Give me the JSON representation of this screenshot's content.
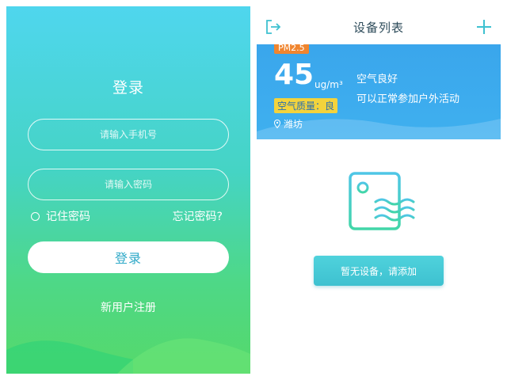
{
  "login": {
    "title": "登录",
    "phone_placeholder": "请输入手机号",
    "password_placeholder": "请输入密码",
    "remember_label": "记住密码",
    "forgot_label": "忘记密码?",
    "login_button": "登录",
    "register_link": "新用户注册"
  },
  "devices": {
    "title": "设备列表",
    "exit_icon": "exit-icon",
    "add_icon": "plus-icon",
    "pm": {
      "badge": "PM2.5",
      "value": "45",
      "unit": "ug/m³",
      "quality_tag": "空气质量：良",
      "location": "潍坊",
      "status_main": "空气良好",
      "status_sub": "可以正常参加户外活动"
    },
    "empty_action": "暂无设备，请添加"
  },
  "colors": {
    "login_gradient_top": "#4fd6ee",
    "login_gradient_bottom": "#55d96a",
    "card_blue": "#3aa6ec",
    "badge_orange": "#f0852f",
    "tag_yellow": "#f3d33c",
    "teal_button": "#3ec1d0"
  }
}
